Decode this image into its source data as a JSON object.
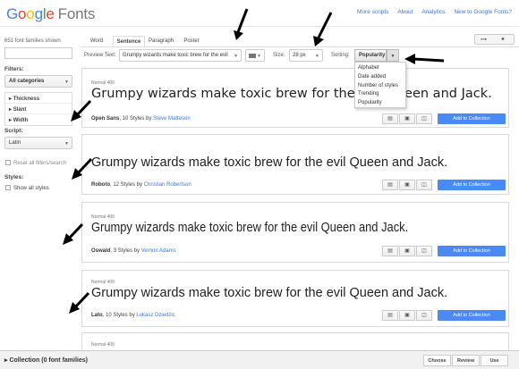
{
  "header": {
    "logo_google": [
      "G",
      "o",
      "o",
      "g",
      "l",
      "e"
    ],
    "logo_fonts": "Fonts",
    "links": [
      "More scripts",
      "About",
      "Analytics",
      "New to Google Fonts?"
    ]
  },
  "sidebar": {
    "count": "651 font families shown",
    "filters_label": "Filters:",
    "category": "All categories",
    "filters": [
      "Thickness",
      "Slant",
      "Width"
    ],
    "script_label": "Script:",
    "script": "Latin",
    "reset": "Reset all filters/search",
    "styles_label": "Styles:",
    "show_all": "Show all styles"
  },
  "tabs": [
    "Word",
    "Sentence",
    "Paragraph",
    "Poster"
  ],
  "controls": {
    "preview_label": "Preview Text:",
    "preview_value": "Grumpy wizards make toxic brew for the evil",
    "size_label": "Size:",
    "size_value": "28 px",
    "sort_label": "Sorting:",
    "sort_value": "Popularity",
    "sort_options": [
      "Alphabet",
      "Date added",
      "Number of styles",
      "Trending",
      "Popularity"
    ]
  },
  "cards": [
    {
      "style": "Normal 400",
      "sample": "Grumpy wizards make toxic brew for the evil Queen and Jack.",
      "font": "Open Sans",
      "styles": ", 10 Styles by ",
      "author": "Steve Matteson",
      "add": "Add to Collection"
    },
    {
      "style": "Normal 400",
      "sample": "Grumpy wizards make toxic brew for the evil Queen and Jack.",
      "font": "Roboto",
      "styles": ", 12 Styles by ",
      "author": "Christian Robertson",
      "add": "Add to Collection"
    },
    {
      "style": "Normal 400",
      "sample": "Grumpy wizards make toxic brew for the evil Queen and Jack.",
      "font": "Oswald",
      "styles": ", 3 Styles by ",
      "author": "Vernon Adams",
      "add": "Add to Collection"
    },
    {
      "style": "Normal 400",
      "sample": "Grumpy wizards make toxic brew for the evil Queen and Jack.",
      "font": "Lato",
      "styles": ", 10 Styles by ",
      "author": "Łukasz Dziedzic",
      "add": "Add to Collection"
    },
    {
      "style": "Normal 400"
    }
  ],
  "footer": {
    "collection": "Collection (0 font families)",
    "buttons": [
      "Choose",
      "Review",
      "Use"
    ]
  },
  "colors": {
    "accent": "#4a8af4",
    "link": "#3b78e7"
  }
}
